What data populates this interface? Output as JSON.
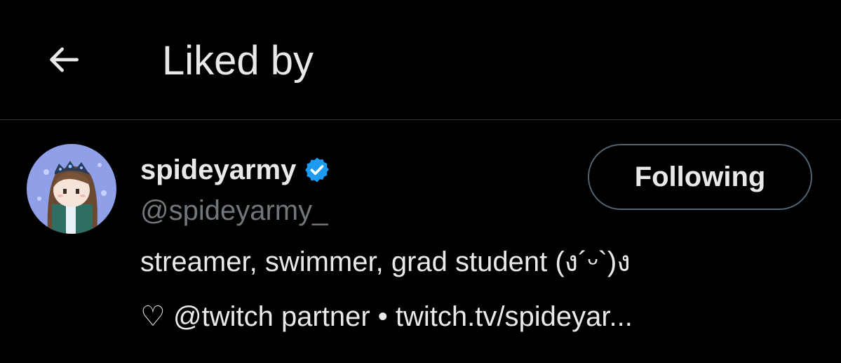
{
  "header": {
    "title": "Liked by",
    "back_icon": "arrow-left-icon"
  },
  "user": {
    "display_name": "spideyarmy",
    "verified_icon": "verified-badge-icon",
    "verified_color": "#1d9bf0",
    "handle": "@spideyarmy_",
    "bio_line1": "streamer, swimmer, grad student (ง´ᵕ`)ง",
    "bio_line2": "♡ @twitch partner • twitch.tv/spideyar...",
    "follow_button_label": "Following"
  },
  "colors": {
    "background": "#000000",
    "text_primary": "#e7e9ea",
    "text_secondary": "#71767b",
    "divider": "#2f3336",
    "button_border": "#536471"
  }
}
